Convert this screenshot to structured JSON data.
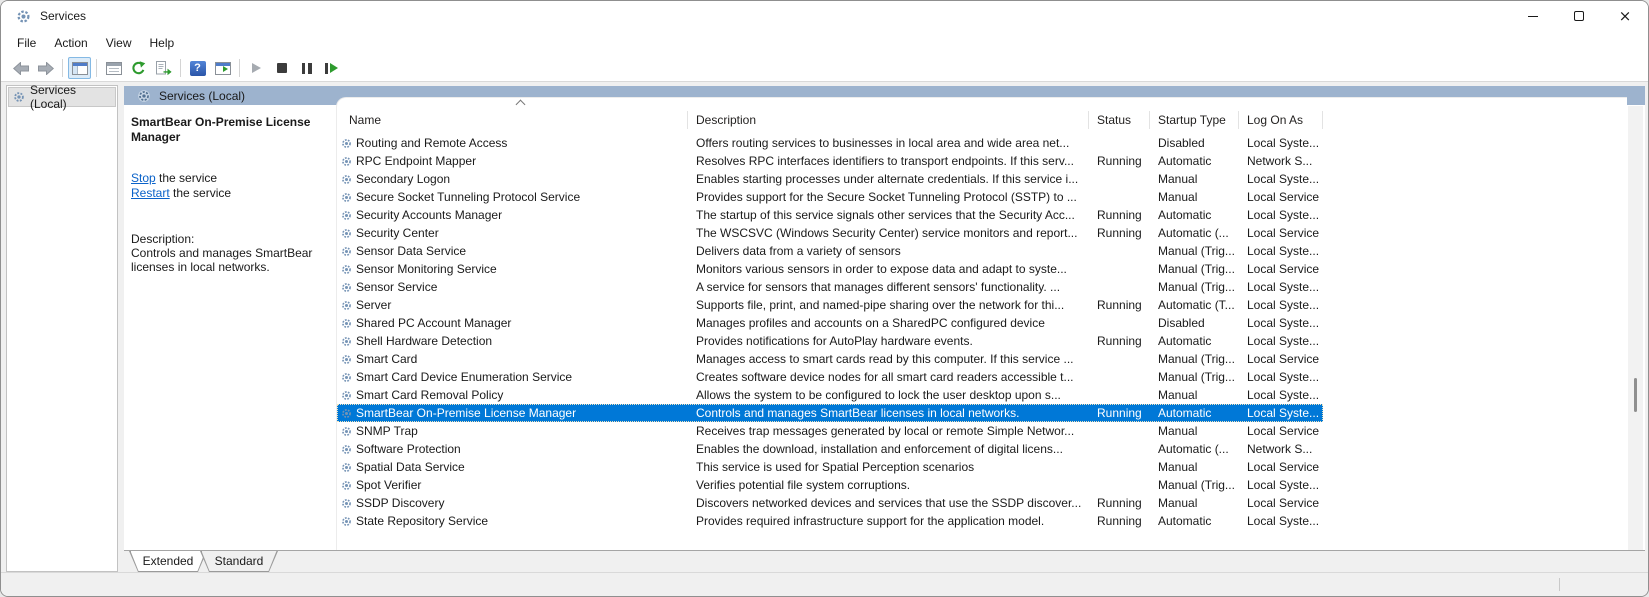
{
  "window": {
    "title": "Services"
  },
  "titlebar_icons": [
    "services-gear-icon",
    "minimize-icon",
    "maximize-icon",
    "close-icon"
  ],
  "menubar": {
    "items": [
      "File",
      "Action",
      "View",
      "Help"
    ]
  },
  "toolbar": {
    "icons": [
      "back-icon",
      "forward-icon",
      "show-console-tree-icon",
      "properties-icon",
      "refresh-icon",
      "export-list-icon",
      "help-icon",
      "show-action-pane-icon",
      "start-service-icon",
      "stop-service-icon",
      "pause-service-icon",
      "restart-service-icon"
    ],
    "help_glyph": "?"
  },
  "tree": {
    "items": [
      {
        "label": "Services (Local)",
        "selected": true
      }
    ]
  },
  "pane": {
    "header_label": "Services (Local)"
  },
  "detail": {
    "service_title": "SmartBear On-Premise License Manager",
    "actions": [
      {
        "link": "Stop",
        "suffix": " the service"
      },
      {
        "link": "Restart",
        "suffix": " the service"
      }
    ],
    "description_label": "Description:",
    "description_text": "Controls and manages SmartBear licenses in local networks."
  },
  "table": {
    "columns": [
      "Name",
      "Description",
      "Status",
      "Startup Type",
      "Log On As"
    ],
    "sort_column": "Name",
    "sort_direction": "ascending",
    "rows": [
      {
        "name": "Routing and Remote Access",
        "description": "Offers routing services to businesses in local area and wide area net...",
        "status": "",
        "startup_type": "Disabled",
        "log_on_as": "Local Syste..."
      },
      {
        "name": "RPC Endpoint Mapper",
        "description": "Resolves RPC interfaces identifiers to transport endpoints. If this serv...",
        "status": "Running",
        "startup_type": "Automatic",
        "log_on_as": "Network S..."
      },
      {
        "name": "Secondary Logon",
        "description": "Enables starting processes under alternate credentials. If this service i...",
        "status": "",
        "startup_type": "Manual",
        "log_on_as": "Local Syste..."
      },
      {
        "name": "Secure Socket Tunneling Protocol Service",
        "description": "Provides support for the Secure Socket Tunneling Protocol (SSTP) to ...",
        "status": "",
        "startup_type": "Manual",
        "log_on_as": "Local Service"
      },
      {
        "name": "Security Accounts Manager",
        "description": "The startup of this service signals other services that the Security Acc...",
        "status": "Running",
        "startup_type": "Automatic",
        "log_on_as": "Local Syste..."
      },
      {
        "name": "Security Center",
        "description": "The WSCSVC (Windows Security Center) service monitors and report...",
        "status": "Running",
        "startup_type": "Automatic (...",
        "log_on_as": "Local Service"
      },
      {
        "name": "Sensor Data Service",
        "description": "Delivers data from a variety of sensors",
        "status": "",
        "startup_type": "Manual (Trig...",
        "log_on_as": "Local Syste..."
      },
      {
        "name": "Sensor Monitoring Service",
        "description": "Monitors various sensors in order to expose data and adapt to syste...",
        "status": "",
        "startup_type": "Manual (Trig...",
        "log_on_as": "Local Service"
      },
      {
        "name": "Sensor Service",
        "description": "A service for sensors that manages different sensors' functionality. ...",
        "status": "",
        "startup_type": "Manual (Trig...",
        "log_on_as": "Local Syste..."
      },
      {
        "name": "Server",
        "description": "Supports file, print, and named-pipe sharing over the network for thi...",
        "status": "Running",
        "startup_type": "Automatic (T...",
        "log_on_as": "Local Syste..."
      },
      {
        "name": "Shared PC Account Manager",
        "description": "Manages profiles and accounts on a SharedPC configured device",
        "status": "",
        "startup_type": "Disabled",
        "log_on_as": "Local Syste..."
      },
      {
        "name": "Shell Hardware Detection",
        "description": "Provides notifications for AutoPlay hardware events.",
        "status": "Running",
        "startup_type": "Automatic",
        "log_on_as": "Local Syste..."
      },
      {
        "name": "Smart Card",
        "description": "Manages access to smart cards read by this computer. If this service ...",
        "status": "",
        "startup_type": "Manual (Trig...",
        "log_on_as": "Local Service"
      },
      {
        "name": "Smart Card Device Enumeration Service",
        "description": "Creates software device nodes for all smart card readers accessible t...",
        "status": "",
        "startup_type": "Manual (Trig...",
        "log_on_as": "Local Syste..."
      },
      {
        "name": "Smart Card Removal Policy",
        "description": "Allows the system to be configured to lock the user desktop upon s...",
        "status": "",
        "startup_type": "Manual",
        "log_on_as": "Local Syste..."
      },
      {
        "name": "SmartBear On-Premise License Manager",
        "description": "Controls and manages SmartBear licenses in local networks.",
        "status": "Running",
        "startup_type": "Automatic",
        "log_on_as": "Local Syste...",
        "selected": true
      },
      {
        "name": "SNMP Trap",
        "description": "Receives trap messages generated by local or remote Simple Networ...",
        "status": "",
        "startup_type": "Manual",
        "log_on_as": "Local Service"
      },
      {
        "name": "Software Protection",
        "description": "Enables the download, installation and enforcement of digital licens...",
        "status": "",
        "startup_type": "Automatic (...",
        "log_on_as": "Network S..."
      },
      {
        "name": "Spatial Data Service",
        "description": "This service is used for Spatial Perception scenarios",
        "status": "",
        "startup_type": "Manual",
        "log_on_as": "Local Service"
      },
      {
        "name": "Spot Verifier",
        "description": "Verifies potential file system corruptions.",
        "status": "",
        "startup_type": "Manual (Trig...",
        "log_on_as": "Local Syste..."
      },
      {
        "name": "SSDP Discovery",
        "description": "Discovers networked devices and services that use the SSDP discover...",
        "status": "Running",
        "startup_type": "Manual",
        "log_on_as": "Local Service"
      },
      {
        "name": "State Repository Service",
        "description": "Provides required infrastructure support for the application model.",
        "status": "Running",
        "startup_type": "Automatic",
        "log_on_as": "Local Syste..."
      }
    ]
  },
  "tabs": [
    {
      "label": "Extended",
      "active": true
    },
    {
      "label": "Standard",
      "active": false
    }
  ],
  "colors": {
    "selection": "#0078d7",
    "pane_header_band": "#9db3ce",
    "link": "#0a62c9",
    "service_icon": "#7593b5"
  }
}
